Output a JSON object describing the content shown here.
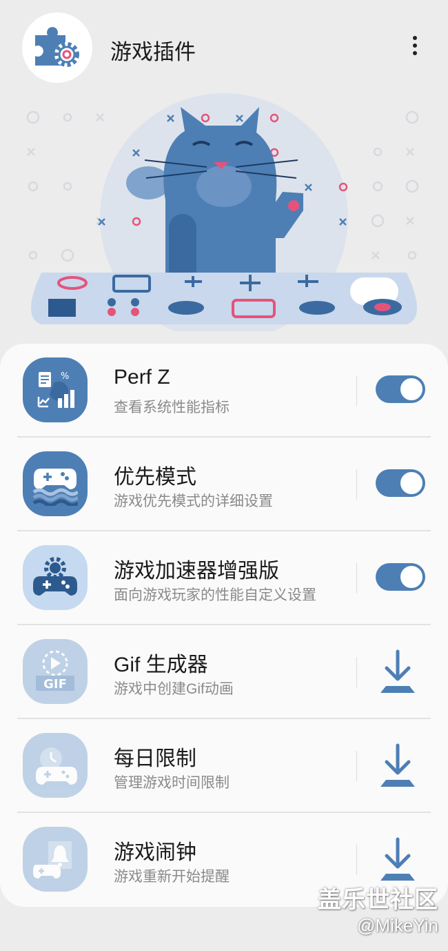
{
  "header": {
    "title": "游戏插件",
    "icon": "puzzle-gear-icon",
    "menu_icon": "more-vert-icon"
  },
  "colors": {
    "accent": "#4d7fb5",
    "pink": "#e5537a",
    "background": "#ececec",
    "card": "#fafafa"
  },
  "plugins": [
    {
      "title": "Perf Z",
      "subtitle": "查看系统性能指标",
      "icon": "performance-chart-icon",
      "control": "toggle",
      "enabled": true
    },
    {
      "title": "优先模式",
      "subtitle": "游戏优先模式的详细设置",
      "icon": "gamepad-waves-icon",
      "control": "toggle",
      "enabled": true
    },
    {
      "title": "游戏加速器增强版",
      "subtitle": "面向游戏玩家的性能自定义设置",
      "icon": "gamepad-gear-icon",
      "control": "toggle",
      "enabled": true
    },
    {
      "title": "Gif 生成器",
      "subtitle": "游戏中创建Gif动画",
      "icon": "gif-play-icon",
      "control": "download"
    },
    {
      "title": "每日限制",
      "subtitle": "管理游戏时间限制",
      "icon": "gamepad-timer-icon",
      "control": "download"
    },
    {
      "title": "游戏闹钟",
      "subtitle": "游戏重新开始提醒",
      "icon": "gamepad-bell-icon",
      "control": "download"
    }
  ],
  "watermark": {
    "line1": "盖乐世社区",
    "line2": "@MikeYin"
  }
}
